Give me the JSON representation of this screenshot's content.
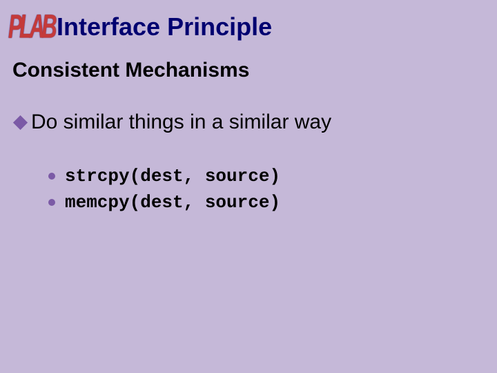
{
  "logo": "PLAB",
  "title": "Interface Principle",
  "subtitle": "Consistent Mechanisms",
  "mainBullet": "Do similar things in a similar way",
  "subItems": [
    "strcpy(dest, source)",
    "memcpy(dest, source)"
  ]
}
